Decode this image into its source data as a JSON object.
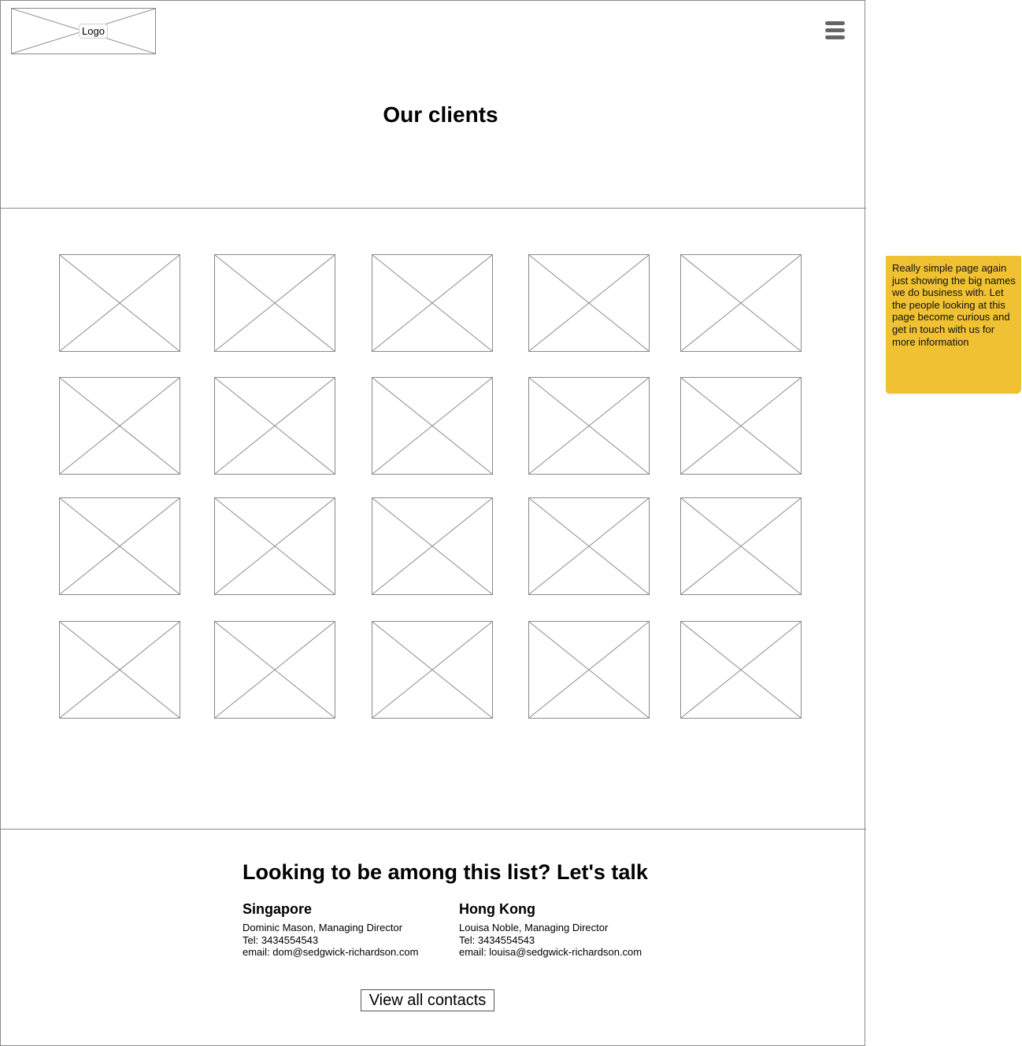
{
  "header": {
    "logo_label": "Logo"
  },
  "page": {
    "title": "Our clients"
  },
  "client_logos_grid": {
    "rows": 4,
    "columns": 5
  },
  "contact": {
    "heading": "Looking to be among this list? Let's talk",
    "offices": [
      {
        "city": "Singapore",
        "person": "Dominic Mason, Managing Director",
        "tel": "Tel: 3434554543",
        "email": "email: dom@sedgwick-richardson.com"
      },
      {
        "city": "Hong Kong",
        "person": "Louisa Noble, Managing Director",
        "tel": "Tel: 3434554543",
        "email": "email: louisa@sedgwick-richardson.com"
      }
    ],
    "button_label": "View all contacts"
  },
  "annotation": {
    "text": "Really simple page again just showing the big names we do business with. Let the people looking at this page become curious and get in touch with us for more information",
    "color": "#f0c132"
  },
  "icons": {
    "menu": "hamburger-menu-icon",
    "placeholder": "image-placeholder-icon"
  }
}
